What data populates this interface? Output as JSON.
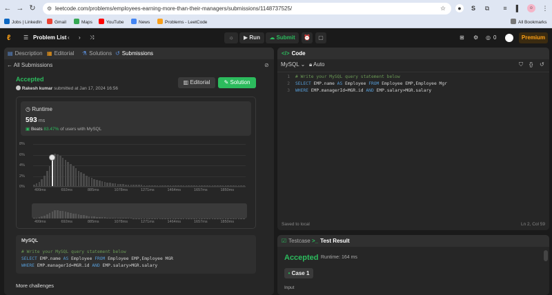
{
  "browser": {
    "url": "leetcode.com/problems/employees-earning-more-than-their-managers/submissions/1148737525/",
    "bookmarks": [
      {
        "label": "Jobs | LinkedIn",
        "color": "#0a66c2"
      },
      {
        "label": "Gmail",
        "color": "#ea4335"
      },
      {
        "label": "Maps",
        "color": "#34a853"
      },
      {
        "label": "YouTube",
        "color": "#ff0000"
      },
      {
        "label": "News",
        "color": "#4285f4"
      },
      {
        "label": "Problems - LeetCode",
        "color": "#f89f1b"
      }
    ],
    "all_bookmarks": "All Bookmarks"
  },
  "header": {
    "problem_list": "Problem List",
    "run": "Run",
    "submit": "Submit",
    "coins": "0",
    "premium": "Premium"
  },
  "left_tabs": {
    "description": "Description",
    "editorial": "Editorial",
    "solutions": "Solutions",
    "submissions": "Submissions"
  },
  "submission": {
    "back": "All Submissions",
    "status": "Accepted",
    "user": "Rakesh kumar",
    "submitted_at": "submitted at Jan 17, 2024 16:56",
    "editorial_btn": "Editorial",
    "solution_btn": "Solution"
  },
  "runtime": {
    "label": "Runtime",
    "value": "593",
    "unit": "ms",
    "beats_prefix": "Beats",
    "beats_pct": "83.47%",
    "beats_suffix": "of users with MySQL"
  },
  "chart_data": {
    "type": "bar",
    "y_ticks": [
      "8%",
      "6%",
      "4%",
      "2%",
      "0%"
    ],
    "x_ticks": [
      "499ms",
      "692ms",
      "885ms",
      "1078ms",
      "1271ms",
      "1464ms",
      "1657ms",
      "1850ms"
    ],
    "ylim": [
      0,
      8
    ],
    "highlight_index": 7,
    "values": [
      0.3,
      0.5,
      0.8,
      1.3,
      2.0,
      2.9,
      3.8,
      5.2,
      6.1,
      6.0,
      5.7,
      5.3,
      4.9,
      4.5,
      4.1,
      3.7,
      3.3,
      2.9,
      2.6,
      2.3,
      2.0,
      1.7,
      1.5,
      1.3,
      1.15,
      1.0,
      0.9,
      0.8,
      0.7,
      0.62,
      0.55,
      0.5,
      0.45,
      0.4,
      0.36,
      0.32,
      0.3,
      0.27,
      0.25,
      0.23,
      0.21,
      0.2,
      0.18,
      0.17,
      0.16,
      0.15,
      0.14,
      0.13,
      0.12,
      0.11,
      0.1,
      0.09,
      0.09,
      0.08,
      0.08,
      0.07,
      0.07,
      0.06,
      0.06,
      0.05,
      0.05,
      0.05,
      0.04,
      0.04,
      0.04,
      0.03,
      0.03,
      0.03,
      0.03,
      0.02,
      0.02,
      0.02,
      0.02,
      0.02,
      0.01,
      0.01,
      0.01,
      0.01,
      0.01,
      0.01,
      0.01
    ]
  },
  "submitted_code": {
    "lang": "MySQL",
    "lines": [
      "# Write your MySQL query statement below",
      "SELECT EMP.name AS Employee FROM Employee EMP,Employee MGR",
      "WHERE EMP.managerId=MGR.id AND EMP.salary>MGR.salary"
    ]
  },
  "more_challenges": "More challenges",
  "editor": {
    "title": "Code",
    "lang": "MySQL",
    "mode": "Auto",
    "line_numbers": [
      "1",
      "2",
      "3"
    ],
    "saved": "Saved to local",
    "position": "Ln 2, Col 59"
  },
  "result_panel": {
    "testcase_tab": "Testcase",
    "result_tab": "Test Result",
    "status": "Accepted",
    "runtime": "Runtime: 164 ms",
    "case": "Case 1",
    "input_label": "Input"
  },
  "colors": {
    "accent_green": "#2cbb5d",
    "beats_green": "#2cbb5d",
    "premium": "#ffa116"
  }
}
